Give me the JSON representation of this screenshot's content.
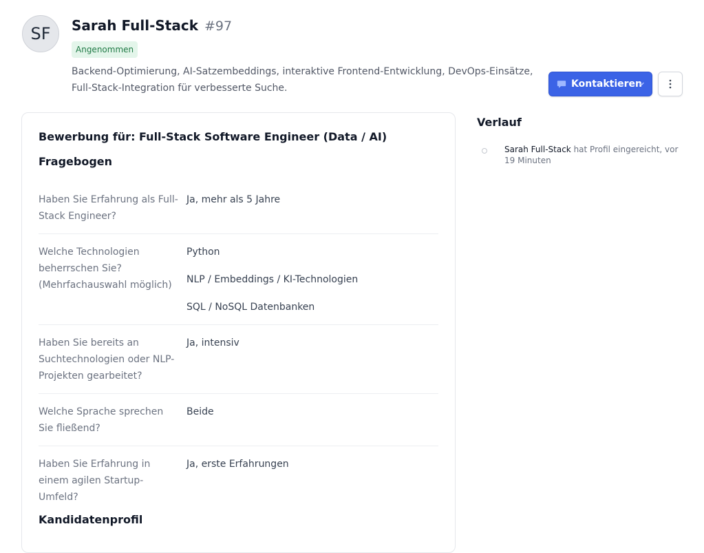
{
  "candidate": {
    "initials": "SF",
    "name": "Sarah Full-Stack",
    "number": "#97",
    "status": "Angenommen",
    "description": "Backend-Optimierung, AI-Satzembeddings, interaktive Frontend-Entwicklung, DevOps-Einsätze, Full-Stack-Integration für verbesserte Suche."
  },
  "actions": {
    "contact_label": "Kontaktieren"
  },
  "application": {
    "title": "Bewerbung für: Full-Stack Software Engineer (Data / AI)",
    "questionnaire_title": "Fragebogen",
    "questions": [
      {
        "q": "Haben Sie Erfahrung als Full-Stack Engineer?",
        "answers": [
          "Ja, mehr als 5 Jahre"
        ]
      },
      {
        "q": "Welche Technologien beherrschen Sie? (Mehrfachauswahl möglich)",
        "answers": [
          "Python",
          "NLP / Embeddings / KI-Technologien",
          "SQL / NoSQL Datenbanken"
        ]
      },
      {
        "q": "Haben Sie bereits an Suchtechnologien oder NLP-Projekten gearbeitet?",
        "answers": [
          "Ja, intensiv"
        ]
      },
      {
        "q": "Welche Sprache sprechen Sie fließend?",
        "answers": [
          "Beide"
        ]
      },
      {
        "q": "Haben Sie Erfahrung in einem agilen Startup-Umfeld?",
        "answers": [
          "Ja, erste Erfahrungen"
        ]
      }
    ],
    "profile_title": "Kandidatenprofil"
  },
  "history": {
    "title": "Verlauf",
    "events": [
      {
        "actor": "Sarah Full-Stack",
        "text": " hat Profil eingereicht, vor 19 Minuten"
      }
    ]
  },
  "icons": {
    "contact": "chat-bubble-icon",
    "dropdown": "chevron-down-icon",
    "more": "more-vertical-icon"
  },
  "colors": {
    "primary": "#3b63e6",
    "badge_bg": "#e3f5ea",
    "badge_text": "#1f7a45"
  }
}
